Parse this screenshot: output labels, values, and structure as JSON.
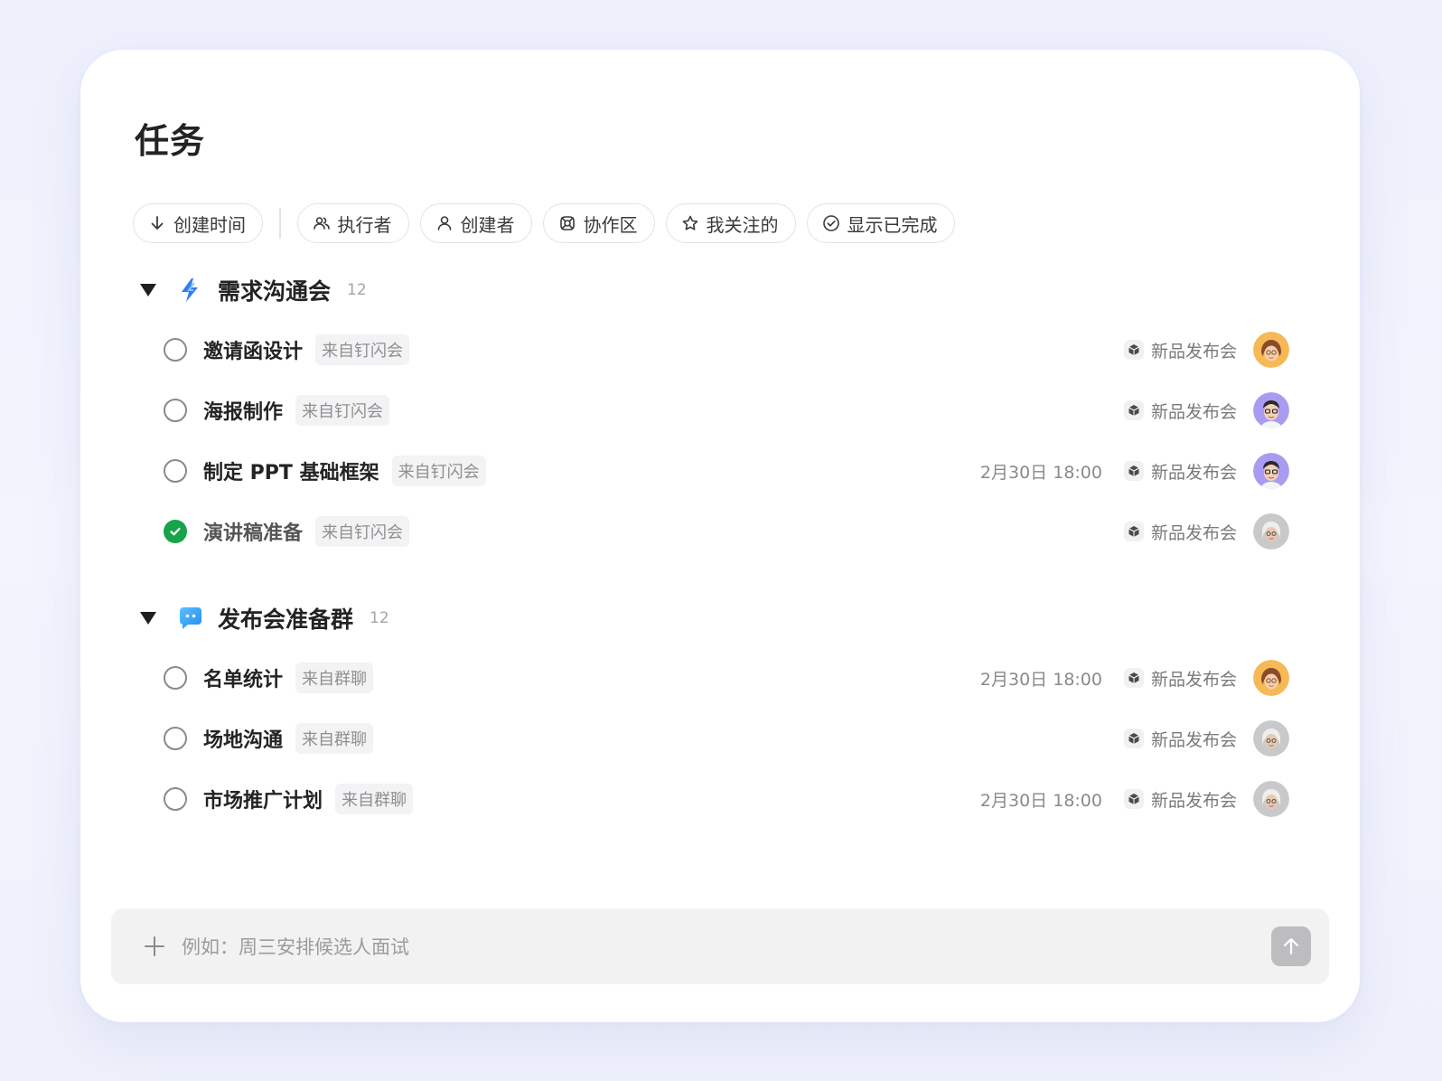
{
  "page": {
    "title": "任务"
  },
  "filters": {
    "sort": "创建时间",
    "items": [
      {
        "label": "执行者",
        "icon": "people-icon"
      },
      {
        "label": "创建者",
        "icon": "person-icon"
      },
      {
        "label": "协作区",
        "icon": "workspace-icon"
      },
      {
        "label": "我关注的",
        "icon": "star-icon"
      },
      {
        "label": "显示已完成",
        "icon": "check-circle-icon"
      }
    ]
  },
  "groups": [
    {
      "name": "需求沟通会",
      "count": "12",
      "icon": "lightning-icon",
      "tasks": [
        {
          "name": "邀请函设计",
          "source": "来自钉闪会",
          "due": "",
          "project": "新品发布会",
          "done": false,
          "avatar": "orange"
        },
        {
          "name": "海报制作",
          "source": "来自钉闪会",
          "due": "",
          "project": "新品发布会",
          "done": false,
          "avatar": "purple"
        },
        {
          "name": "制定 PPT 基础框架",
          "source": "来自钉闪会",
          "due": "2月30日 18:00",
          "project": "新品发布会",
          "done": false,
          "avatar": "purple"
        },
        {
          "name": "演讲稿准备",
          "source": "来自钉闪会",
          "due": "",
          "project": "新品发布会",
          "done": true,
          "avatar": "gray"
        }
      ]
    },
    {
      "name": "发布会准备群",
      "count": "12",
      "icon": "chat-bubble-icon",
      "tasks": [
        {
          "name": "名单统计",
          "source": "来自群聊",
          "due": "2月30日 18:00",
          "project": "新品发布会",
          "done": false,
          "avatar": "orange"
        },
        {
          "name": "场地沟通",
          "source": "来自群聊",
          "due": "",
          "project": "新品发布会",
          "done": false,
          "avatar": "gray"
        },
        {
          "name": "市场推广计划",
          "source": "来自群聊",
          "due": "2月30日 18:00",
          "project": "新品发布会",
          "done": false,
          "avatar": "gray"
        }
      ]
    }
  ],
  "composer": {
    "placeholder": "例如：周三安排候选人面试"
  },
  "colors": {
    "done_green": "#16a34a",
    "accent_blue": "#2f7cf6",
    "avatar_orange": "#f7b955",
    "avatar_purple": "#a99cf0",
    "avatar_gray": "#c9c9cc"
  }
}
